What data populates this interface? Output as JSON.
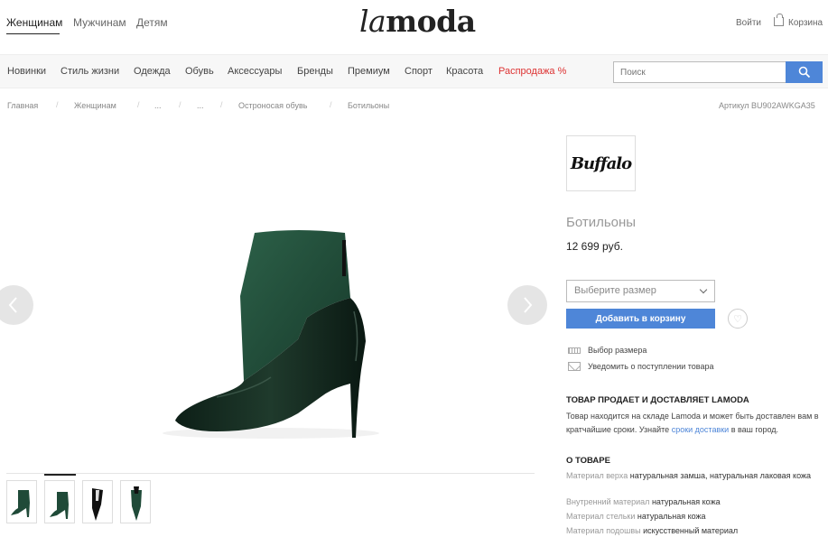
{
  "header": {
    "top_links": [
      "Женщинам",
      "Мужчинам",
      "Детям"
    ],
    "logo_part1": "la",
    "logo_part2": "moda",
    "login": "Войти",
    "cart": "Корзина"
  },
  "nav": {
    "items": [
      "Новинки",
      "Стиль жизни",
      "Одежда",
      "Обувь",
      "Аксессуары",
      "Бренды",
      "Премиум",
      "Спорт",
      "Красота",
      "Распродажа %"
    ],
    "search_placeholder": "Поиск"
  },
  "breadcrumb": {
    "items": [
      "Главная",
      "Женщинам",
      "...",
      "...",
      "Остроносая обувь",
      "Ботильоны"
    ],
    "article": "Артикул BU902AWKGA35"
  },
  "product": {
    "brand": "Buffalo",
    "title": "Ботильоны",
    "price": "12 699 руб.",
    "size_placeholder": "Выберите размер",
    "add_to_cart": "Добавить в корзину",
    "size_guide": "Выбор размера",
    "notify": "Уведомить о поступлении товара"
  },
  "seller": {
    "title": "ТОВАР ПРОДАЕТ И ДОСТАВЛЯЕТ LAMODA",
    "text1": "Товар находится на складе Lamoda и может быть доставлен вам в кратчайшие сроки. Узнайте ",
    "link": "сроки доставки",
    "text2": " в ваш город."
  },
  "about": {
    "title": "О ТОВАРЕ",
    "specs": [
      {
        "key": "Материал верха",
        "value": "натуральная замша, натуральная лаковая кожа"
      },
      {
        "key": "Внутренний материал",
        "value": "натуральная кожа"
      },
      {
        "key": "Материал стельки",
        "value": "натуральная кожа"
      },
      {
        "key": "Материал подошвы",
        "value": "искусственный материал"
      }
    ]
  },
  "colors": {
    "accent": "#4e86d8",
    "sale": "#dd3333",
    "boot": "#1f4a38"
  }
}
